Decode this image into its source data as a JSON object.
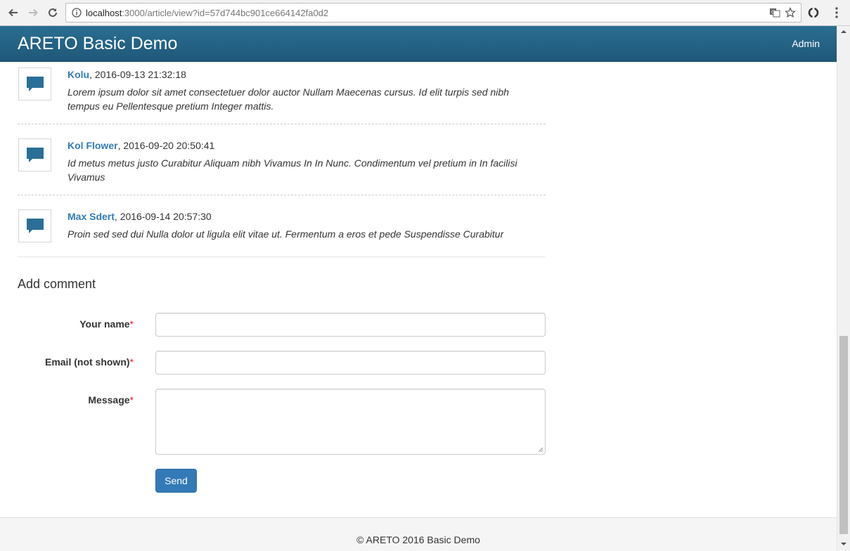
{
  "browser": {
    "url_host": "localhost",
    "url_rest": ":3000/article/view?id=57d744bc901ce664142fa0d2"
  },
  "navbar": {
    "brand": "ARETO Basic Demo",
    "admin_link": "Admin"
  },
  "comments": [
    {
      "author": "Kolu",
      "date": ", 2016-09-13 21:32:18",
      "text": "Lorem ipsum dolor sit amet consectetuer dolor auctor Nullam Maecenas cursus. Id elit turpis sed nibh tempus eu Pellentesque pretium Integer mattis."
    },
    {
      "author": "Kol Flower",
      "date": ", 2016-09-20 20:50:41",
      "text": "Id metus metus justo Curabitur Aliquam nibh Vivamus In In Nunc. Condimentum vel pretium in In facilisi Vivamus"
    },
    {
      "author": "Max Sdert",
      "date": ", 2016-09-14 20:57:30",
      "text": "Proin sed sed dui Nulla dolor ut ligula elit vitae ut. Fermentum a eros et pede Suspendisse Curabitur"
    }
  ],
  "form": {
    "title": "Add comment",
    "name_label": "Your name",
    "email_label": "Email (not shown)",
    "message_label": "Message",
    "required_mark": "*",
    "name_value": "",
    "email_value": "",
    "message_value": "",
    "send_label": "Send"
  },
  "footer": {
    "text": "© ARETO 2016 Basic Demo"
  },
  "colors": {
    "navbar": "#1f5878",
    "link": "#337ab7",
    "button": "#337ab7",
    "comment_icon": "#2a6f97"
  }
}
